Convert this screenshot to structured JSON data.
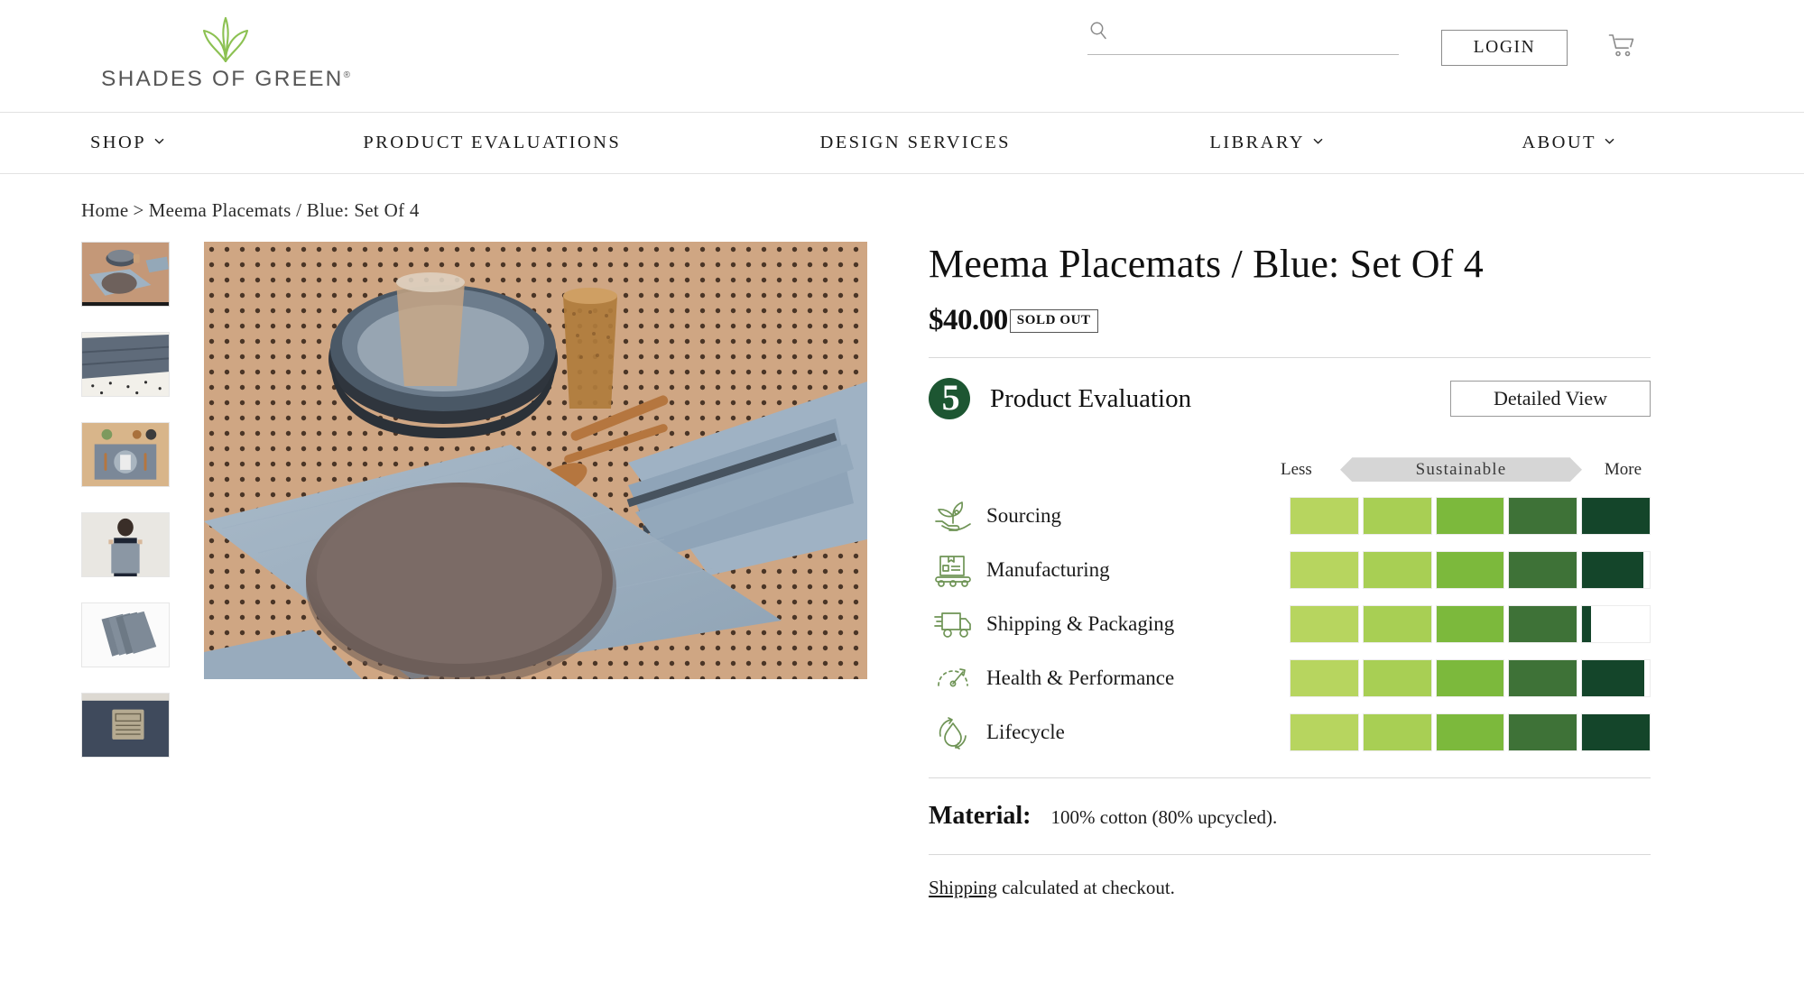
{
  "header": {
    "logo": {
      "mark": "lotus-leaf-mark",
      "word": "SHADES OF GREEN",
      "registered": "®"
    },
    "search": {
      "placeholder": "",
      "value": "",
      "icon": "search-icon"
    },
    "login_label": "LOGIN",
    "cart": {
      "icon": "shopping-cart-icon",
      "count": ""
    }
  },
  "nav": {
    "items": [
      {
        "label": "SHOP",
        "has_dropdown": true
      },
      {
        "label": "PRODUCT EVALUATIONS",
        "has_dropdown": false
      },
      {
        "label": "DESIGN SERVICES",
        "has_dropdown": false
      },
      {
        "label": "LIBRARY",
        "has_dropdown": true
      },
      {
        "label": "ABOUT",
        "has_dropdown": true
      }
    ]
  },
  "breadcrumb": {
    "home": "Home",
    "separator": ">",
    "current": "Meema Placemats / Blue: Set Of 4"
  },
  "gallery": {
    "thumbnails": [
      {
        "alt": "Table setting with placemat, bowl and plate",
        "selected": true
      },
      {
        "alt": "Folded blue placemats on polka dot surface",
        "selected": false
      },
      {
        "alt": "Overhead place setting on wood table",
        "selected": false
      },
      {
        "alt": "Person holding blue placemat",
        "selected": false
      },
      {
        "alt": "Stack of four blue placemats",
        "selected": false
      },
      {
        "alt": "Close up of woven label on placemat",
        "selected": false
      }
    ],
    "hero_alt": "Blue placemat with mauve plate, dark bowls, amber glass and copper cutlery on tan perforated table"
  },
  "product": {
    "title": "Meema Placemats / Blue: Set Of 4",
    "price": "$40.00",
    "stock_badge": "SOLD OUT",
    "material_label": "Material:",
    "material_value": "100% cotton (80% upcycled).",
    "shipping_link": "Shipping",
    "shipping_text": "calculated at checkout."
  },
  "evaluation": {
    "score": "5",
    "title": "Product Evaluation",
    "detailed_view_label": "Detailed View",
    "scale": {
      "less": "Less",
      "band": "Sustainable",
      "more": "More"
    },
    "segment_colors": [
      "#b7d55f",
      "#a8cf54",
      "#7cb93c",
      "#3e7237",
      "#14452a"
    ],
    "score_badge_color": "#1d5632",
    "rows": [
      {
        "label": "Sourcing",
        "icon": "hand-with-plant-icon",
        "filled": 5,
        "partial": 1.0
      },
      {
        "label": "Manufacturing",
        "icon": "box-conveyor-icon",
        "filled": 5,
        "partial": 0.9
      },
      {
        "label": "Shipping & Packaging",
        "icon": "delivery-truck-icon",
        "filled": 5,
        "partial": 0.13
      },
      {
        "label": "Health & Performance",
        "icon": "gauge-icon",
        "filled": 5,
        "partial": 0.92
      },
      {
        "label": "Lifecycle",
        "icon": "water-drop-recycle-icon",
        "filled": 5,
        "partial": 1.0
      }
    ]
  }
}
